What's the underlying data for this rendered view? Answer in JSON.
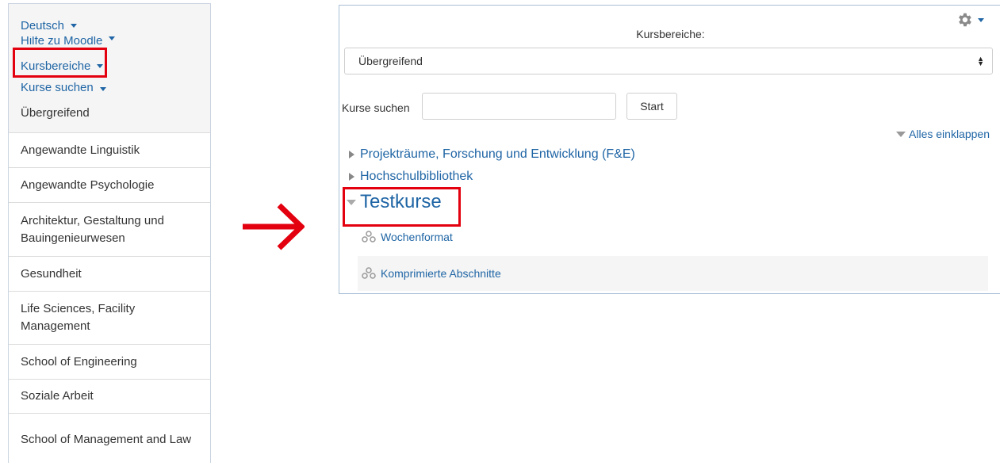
{
  "left_nav": {
    "language": "Deutsch",
    "help": "Hilfe zu Moodle",
    "course_areas": "Kursbereiche",
    "search_courses": "Kurse suchen",
    "categories": [
      "Übergreifend",
      "Angewandte Linguistik",
      "Angewandte Psychologie",
      "Architektur, Gestaltung und Bauingenieurwesen",
      "Gesundheit",
      "Life Sciences, Facility Management",
      "School of Engineering",
      "Soziale Arbeit",
      "School of Management and Law"
    ]
  },
  "right_panel": {
    "select_label": "Kursbereiche:",
    "select_value": "Übergreifend",
    "search_label": "Kurse suchen",
    "search_placeholder": "",
    "start_button": "Start",
    "collapse_all": "Alles einklappen",
    "categories": {
      "projekt": "Projekträume, Forschung und Entwicklung (F&E)",
      "bibliothek": "Hochschulbibliothek",
      "testkurse": "Testkurse"
    },
    "courses": [
      "Wochenformat",
      "Komprimierte Abschnitte"
    ]
  },
  "colors": {
    "highlight": "#e3000f",
    "link": "#1f65a5",
    "arrow": "#e3000f"
  },
  "icons": [
    "chevron-down-icon",
    "gear-icon",
    "arrow-right-icon",
    "course-icon",
    "triangle-right-icon",
    "triangle-down-icon"
  ]
}
